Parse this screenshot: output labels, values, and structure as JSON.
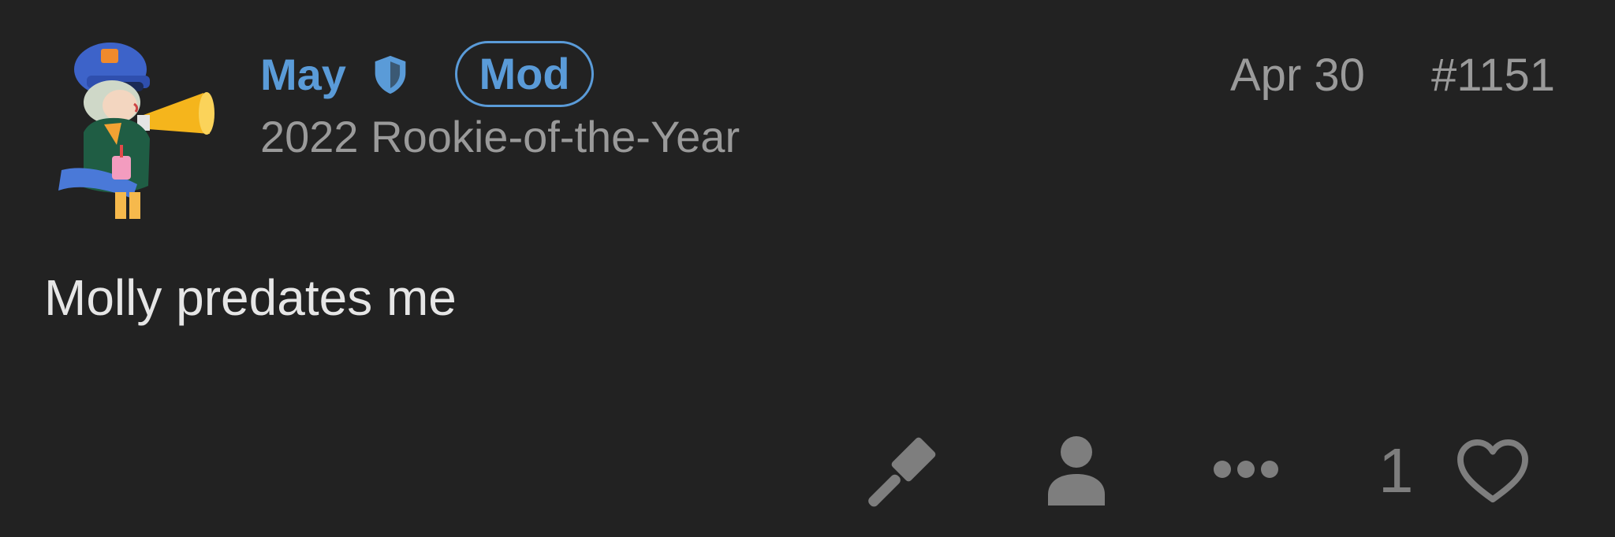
{
  "post": {
    "author": {
      "username": "May",
      "badge": "Mod",
      "title": "2022 Rookie-of-the-Year",
      "avatar_icon": "user-avatar-icon",
      "moderator_icon": "shield-icon"
    },
    "date": "Apr 30",
    "number": "#1151",
    "body": "Molly predates me",
    "actions": {
      "icons": [
        "gavel-icon",
        "user-icon",
        "more-icon",
        "heart-icon"
      ],
      "like_count": "1"
    }
  },
  "colors": {
    "background": "#222222",
    "accent": "#5a9bd8",
    "muted_text": "#9a9a9a",
    "body_text": "#e6e6e6",
    "icon": "#7e7e7e"
  }
}
